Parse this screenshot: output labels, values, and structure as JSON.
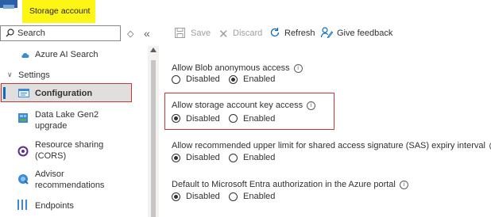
{
  "header": {
    "title": "Storage account"
  },
  "search": {
    "placeholder": "Search"
  },
  "nav": {
    "items": [
      {
        "label": "Azure AI Search"
      },
      {
        "label": "Settings"
      },
      {
        "label": "Configuration"
      },
      {
        "label": "Data Lake Gen2 upgrade"
      },
      {
        "label": "Resource sharing (CORS)"
      },
      {
        "label": "Advisor recommendations"
      },
      {
        "label": "Endpoints"
      }
    ]
  },
  "toolbar": {
    "save": "Save",
    "discard": "Discard",
    "refresh": "Refresh",
    "feedback": "Give feedback"
  },
  "settings": [
    {
      "label": "Allow Blob anonymous access",
      "options": [
        "Disabled",
        "Enabled"
      ],
      "selected": "Enabled"
    },
    {
      "label": "Allow storage account key access",
      "options": [
        "Disabled",
        "Enabled"
      ],
      "selected": "Disabled"
    },
    {
      "label": "Allow recommended upper limit for shared access signature (SAS) expiry interval",
      "options": [
        "Disabled",
        "Enabled"
      ],
      "selected": "Disabled"
    },
    {
      "label": "Default to Microsoft Entra authorization in the Azure portal",
      "options": [
        "Disabled",
        "Enabled"
      ],
      "selected": "Disabled"
    }
  ],
  "colors": {
    "highlight": "#fdf514",
    "accent": "#0f6cbd",
    "callout": "#d13438"
  }
}
